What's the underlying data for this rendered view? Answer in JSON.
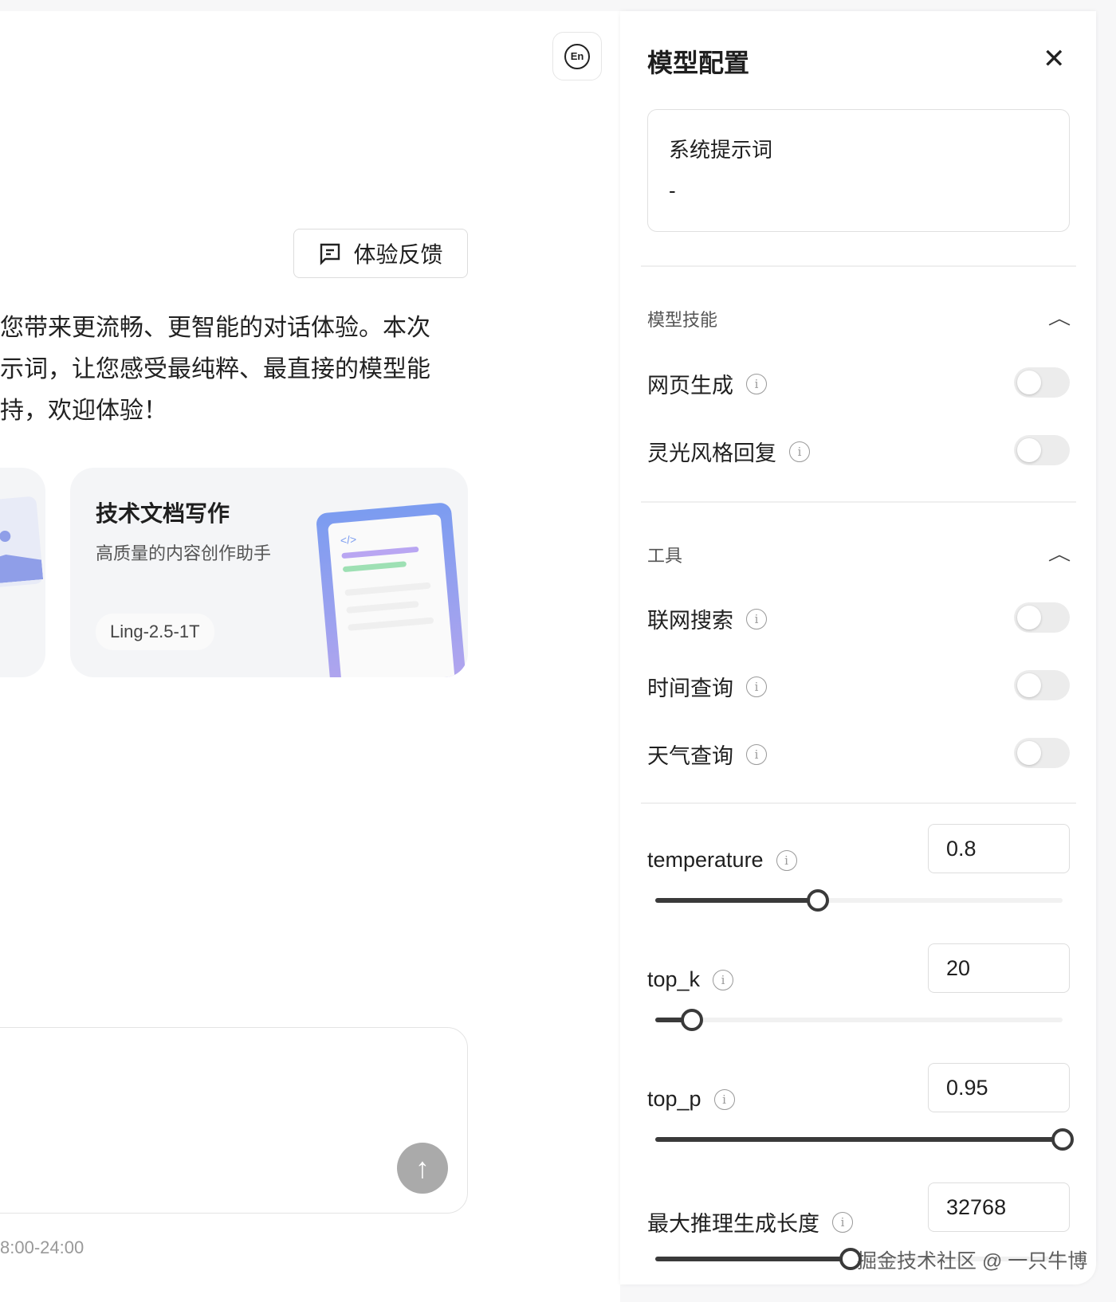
{
  "main": {
    "lang_button": "En",
    "feedback_label": "体验反馈",
    "intro_lines": [
      "您带来更流畅、更智能的对话体验。本次",
      "示词，让您感受最纯粹、最直接的模型能",
      "持，欢迎体验！"
    ],
    "card": {
      "title": "技术文档写作",
      "subtitle": "高质量的内容创作助手",
      "tag": "Ling-2.5-1T",
      "code_glyph": "</>"
    },
    "service_hours": "8:00-24:00"
  },
  "panel": {
    "title": "模型配置",
    "system_prompt": {
      "label": "系统提示词",
      "value": "-"
    },
    "skills": {
      "title": "模型技能",
      "items": [
        {
          "label": "网页生成",
          "on": false
        },
        {
          "label": "灵光风格回复",
          "on": false
        }
      ]
    },
    "tools": {
      "title": "工具",
      "items": [
        {
          "label": "联网搜索",
          "on": false
        },
        {
          "label": "时间查询",
          "on": false
        },
        {
          "label": "天气查询",
          "on": false
        }
      ]
    },
    "params": [
      {
        "label": "temperature",
        "value": "0.8",
        "fill": 0.4
      },
      {
        "label": "top_k",
        "value": "20",
        "fill": 0.09
      },
      {
        "label": "top_p",
        "value": "0.95",
        "fill": 1.0
      },
      {
        "label": "最大推理生成长度",
        "value": "32768",
        "fill": 0.48
      }
    ]
  },
  "watermark": "掘金技术社区 @ 一只牛博"
}
